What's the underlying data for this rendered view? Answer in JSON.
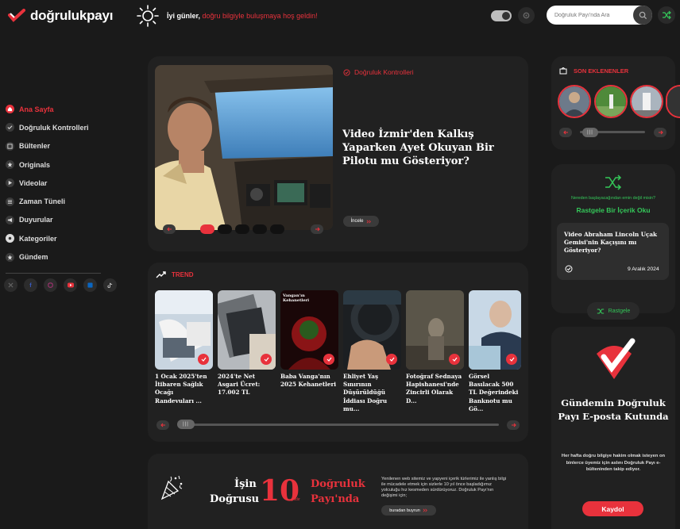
{
  "header": {
    "logo_text": "doğrulukpayı",
    "greeting_hi": "İyi günler,",
    "greeting_msg": "doğru bilgiyle buluşmaya hoş geldin!",
    "search_placeholder": "Doğruluk Payı'nda Ara",
    "icons": [
      "sun-icon",
      "gear-icon",
      "search-icon",
      "shuffle-icon"
    ]
  },
  "sidebar": {
    "items": [
      {
        "label": "Ana Sayfa",
        "icon": "home-icon",
        "active": true
      },
      {
        "label": "Doğruluk Kontrolleri",
        "icon": "check-icon"
      },
      {
        "label": "Bültenler",
        "icon": "newsletter-icon"
      },
      {
        "label": "Originals",
        "icon": "star-icon"
      },
      {
        "label": "Videolar",
        "icon": "play-icon"
      },
      {
        "label": "Zaman Tüneli",
        "icon": "timeline-icon"
      },
      {
        "label": "Duyurular",
        "icon": "megaphone-icon"
      },
      {
        "label": "Kategoriler",
        "icon": "category-icon"
      },
      {
        "label": "Gündem",
        "icon": "agenda-icon"
      }
    ],
    "socials": [
      "x-icon",
      "facebook-icon",
      "instagram-icon",
      "youtube-icon",
      "linkedin-icon",
      "tiktok-icon"
    ]
  },
  "feature": {
    "category": "Doğruluk Kontrolleri",
    "title": "Video İzmir'den Kalkış Yaparken Ayet Okuyan Bir Pilotu mu Gösteriyor?",
    "button": "İncele",
    "slide_count": 5,
    "active_slide": 1
  },
  "trend": {
    "heading": "TREND",
    "items": [
      {
        "title": "1 Ocak 2025'ten İtibaren Sağlık Ocağı Randevuları ..."
      },
      {
        "title": "2024'te Net Asgari Ücret: 17.002 TL"
      },
      {
        "title": "Baba Vanga'nın 2025 Kehanetleri",
        "thumb_text": "Vangan'ın Kehanetleri"
      },
      {
        "title": "Ehliyet Yaş Sınırının Düşürüldüğü İddiası Doğru mu..."
      },
      {
        "title": "Fotoğraf Sednaya Hapishanesi'nde Zincirli Olarak D..."
      },
      {
        "title": "Görsel Basılacak 500 TL Değerindeki Banknotu mu Gö..."
      }
    ],
    "scroll_handle": "|||"
  },
  "banner": {
    "word1": "İşin",
    "word2": "Doğrusu",
    "number": "10",
    "yildir": "yıldır",
    "word3": "Doğruluk",
    "word4": "Payı'nda",
    "text": "Yenilenen web sitemiz ve yapyeni içerik türlerimiz ile yanlış bilgi ile mücadele etmek için sizlerle 10 yıl önce başladığımız yolculuğu hız kesmeden sürdürüyoruz. Doğruluk Payı'nın değişimi için;",
    "button": "buradan buyrun"
  },
  "latest": {
    "heading": "SON EKLENENLER",
    "scroll_handle": "|||"
  },
  "random": {
    "question": "Nereden başlayacağından emin değil misin?",
    "title": "Rastgele Bir İçerik Oku",
    "card_title": "Video Abraham Lincoln Uçak Gemisi'nin Kaçışını mı Gösteriyor?",
    "card_date": "9 Aralık 2024",
    "button": "Rastgele"
  },
  "newsletter": {
    "title": "Gündemin Doğruluk Payı E-posta Kutunda",
    "text": "Her hafta doğru bilgiye hakim olmak isteyen on binlerce üyemiz için aslını Doğruluk Payı e-bülteninden takip ediyor.",
    "button": "Kaydol"
  },
  "colors": {
    "accent": "#e8323c",
    "green": "#34c759",
    "bg": "#1a1a1a",
    "card": "#212121"
  }
}
